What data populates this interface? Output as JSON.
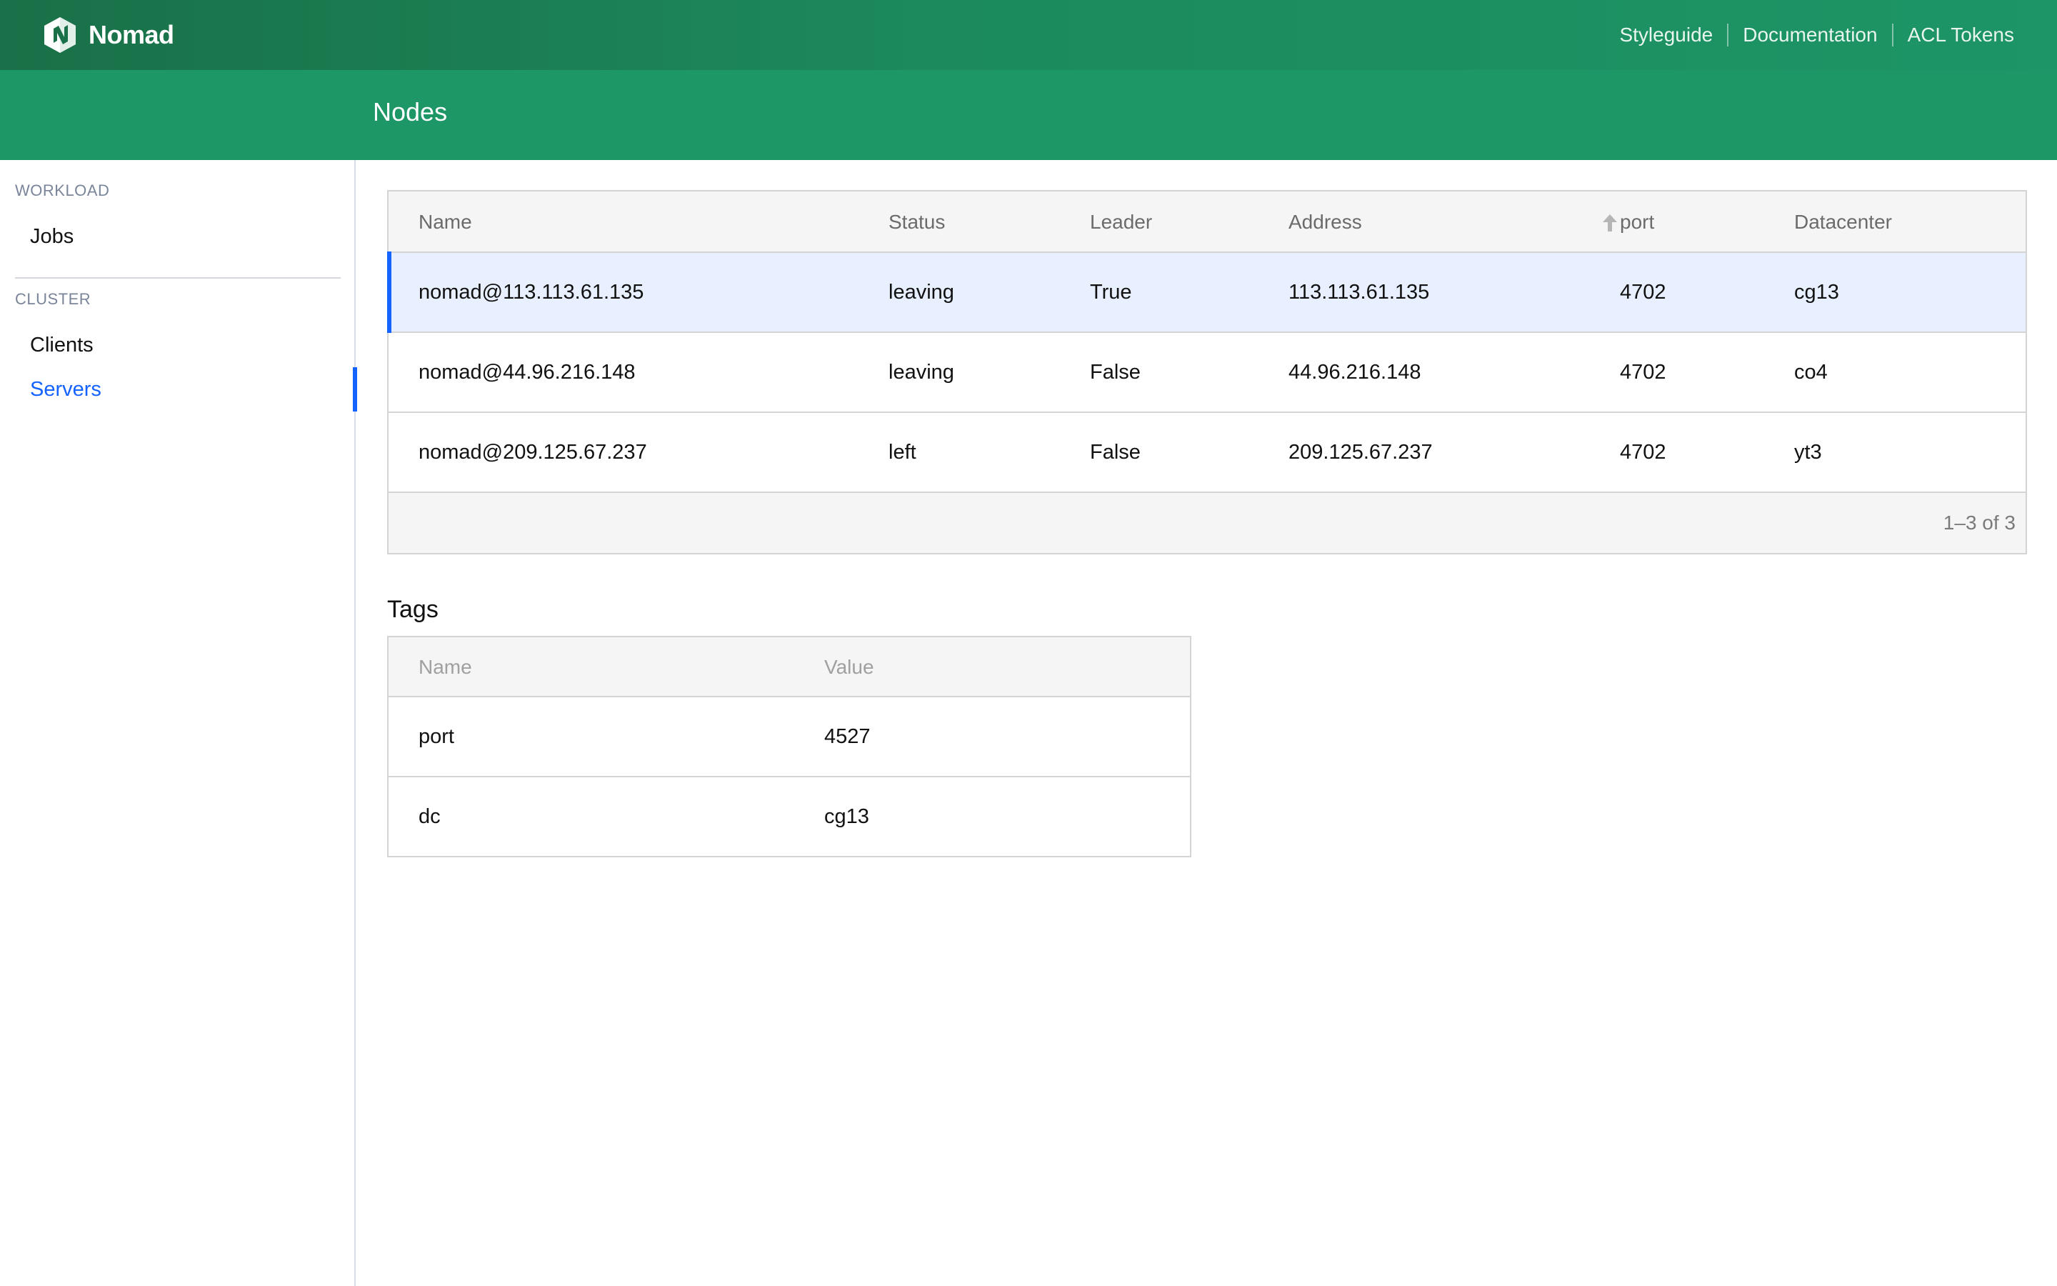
{
  "header": {
    "brand": "Nomad",
    "links": [
      "Styleguide",
      "Documentation",
      "ACL Tokens"
    ],
    "color": "#1c8a5b"
  },
  "subnav": {
    "title": "Nodes"
  },
  "sidebar": {
    "sections": [
      {
        "label": "WORKLOAD",
        "items": [
          {
            "label": "Jobs"
          }
        ]
      },
      {
        "label": "CLUSTER",
        "items": [
          {
            "label": "Clients"
          },
          {
            "label": "Servers",
            "active": true
          }
        ]
      }
    ],
    "accent": "#1563ff"
  },
  "servers_table": {
    "columns": [
      "Name",
      "Status",
      "Leader",
      "Address",
      "port",
      "Datacenter"
    ],
    "sort_icon": "sort-ascending-icon",
    "rows": [
      {
        "name": "nomad@113.113.61.135",
        "status": "leaving",
        "leader": "True",
        "address": "113.113.61.135",
        "port": "4702",
        "datacenter": "cg13",
        "selected": true
      },
      {
        "name": "nomad@44.96.216.148",
        "status": "leaving",
        "leader": "False",
        "address": "44.96.216.148",
        "port": "4702",
        "datacenter": "co4"
      },
      {
        "name": "nomad@209.125.67.237",
        "status": "left",
        "leader": "False",
        "address": "209.125.67.237",
        "port": "4702",
        "datacenter": "yt3"
      }
    ],
    "pagination": "1–3 of 3"
  },
  "tags": {
    "title": "Tags",
    "columns": [
      "Name",
      "Value"
    ],
    "rows": [
      {
        "name": "port",
        "value": "4527"
      },
      {
        "name": "dc",
        "value": "cg13"
      }
    ]
  }
}
